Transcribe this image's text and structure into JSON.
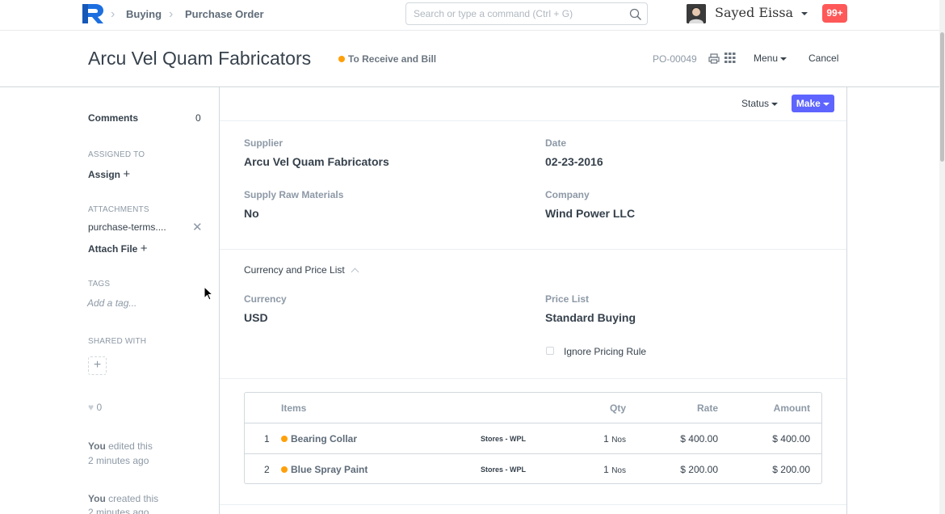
{
  "navbar": {
    "breadcrumbs": [
      "Buying",
      "Purchase Order"
    ],
    "search_placeholder": "Search or type a command (Ctrl + G)",
    "user_name": "Sayed Eissa",
    "notification_count": "99+"
  },
  "page_head": {
    "title": "Arcu Vel Quam Fabricators",
    "status": "To Receive and Bill",
    "doc_name": "PO-00049",
    "menu_label": "Menu",
    "cancel_label": "Cancel"
  },
  "sidebar": {
    "comments_label": "Comments",
    "comments_count": "0",
    "assigned_to_label": "ASSIGNED TO",
    "assign_label": "Assign",
    "attachments_label": "ATTACHMENTS",
    "attachment_file": "purchase-terms....",
    "attach_file_label": "Attach File",
    "tags_label": "TAGS",
    "add_tag_placeholder": "Add a tag...",
    "shared_with_label": "SHARED WITH",
    "likes_count": "0",
    "activity": [
      {
        "who": "You",
        "action": " edited this",
        "when": "2 minutes ago"
      },
      {
        "who": "You",
        "action": " created this",
        "when": "2 minutes ago"
      }
    ]
  },
  "toolbar": {
    "status_label": "Status",
    "make_label": "Make"
  },
  "details": {
    "supplier_label": "Supplier",
    "supplier": "Arcu Vel Quam Fabricators",
    "date_label": "Date",
    "date": "02-23-2016",
    "supply_raw_label": "Supply Raw Materials",
    "supply_raw": "No",
    "company_label": "Company",
    "company": "Wind Power LLC"
  },
  "currency_section": {
    "heading": "Currency and Price List",
    "currency_label": "Currency",
    "currency": "USD",
    "price_list_label": "Price List",
    "price_list": "Standard Buying",
    "ignore_pricing_label": "Ignore Pricing Rule"
  },
  "items_table": {
    "headers": {
      "items": "Items",
      "qty": "Qty",
      "rate": "Rate",
      "amount": "Amount"
    },
    "rows": [
      {
        "idx": "1",
        "item": "Bearing Collar",
        "warehouse": "Stores - WPL",
        "qty": "1",
        "uom": "Nos",
        "rate": "$ 400.00",
        "amount": "$ 400.00"
      },
      {
        "idx": "2",
        "item": "Blue Spray Paint",
        "warehouse": "Stores - WPL",
        "qty": "1",
        "uom": "Nos",
        "rate": "$ 200.00",
        "amount": "$ 200.00"
      }
    ]
  },
  "colors": {
    "primary": "#5e64ff",
    "status_orange": "#ffa00a",
    "notification_red": "#ff5858"
  }
}
